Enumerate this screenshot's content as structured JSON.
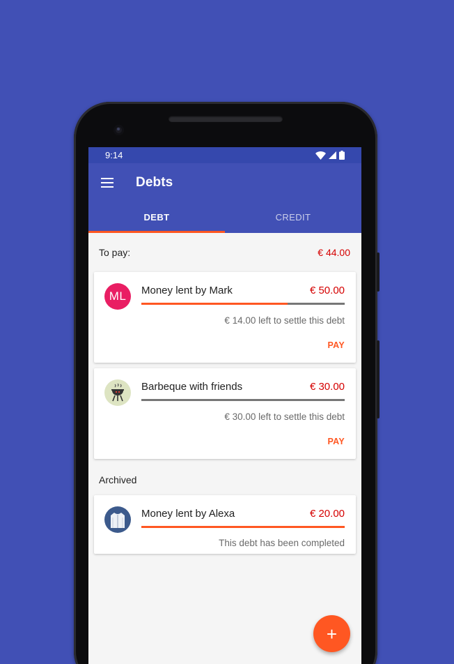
{
  "status_bar": {
    "time": "9:14",
    "icons": [
      "wifi-icon",
      "signal-icon",
      "battery-icon"
    ]
  },
  "app_bar": {
    "title": "Debts",
    "menu_icon": "hamburger-menu-icon"
  },
  "tabs": [
    {
      "label": "DEBT",
      "active": true
    },
    {
      "label": "CREDIT",
      "active": false
    }
  ],
  "summary": {
    "label": "To pay:",
    "amount": "€ 44.00"
  },
  "debts": [
    {
      "avatar_text": "ML",
      "avatar_type": "initials",
      "title": "Money lent by Mark",
      "amount": "€ 50.00",
      "progress": 0.72,
      "note": "€ 14.00 left to settle this debt",
      "action": "PAY"
    },
    {
      "avatar_type": "barbecue-icon",
      "title": "Barbeque with friends",
      "amount": "€ 30.00",
      "progress": 0.0,
      "note": "€ 30.00 left to settle this debt",
      "action": "PAY"
    }
  ],
  "archived_label": "Archived",
  "archived": [
    {
      "avatar_type": "shirt-icon",
      "title": "Money lent by Alexa",
      "amount": "€ 20.00",
      "progress": 1.0,
      "note": "This debt has been completed"
    }
  ],
  "fab_label": "+",
  "colors": {
    "background": "#4150b5",
    "primary": "#4150b5",
    "primary_dark": "#3548ad",
    "accent": "#ff5722",
    "amount": "#d50000"
  }
}
